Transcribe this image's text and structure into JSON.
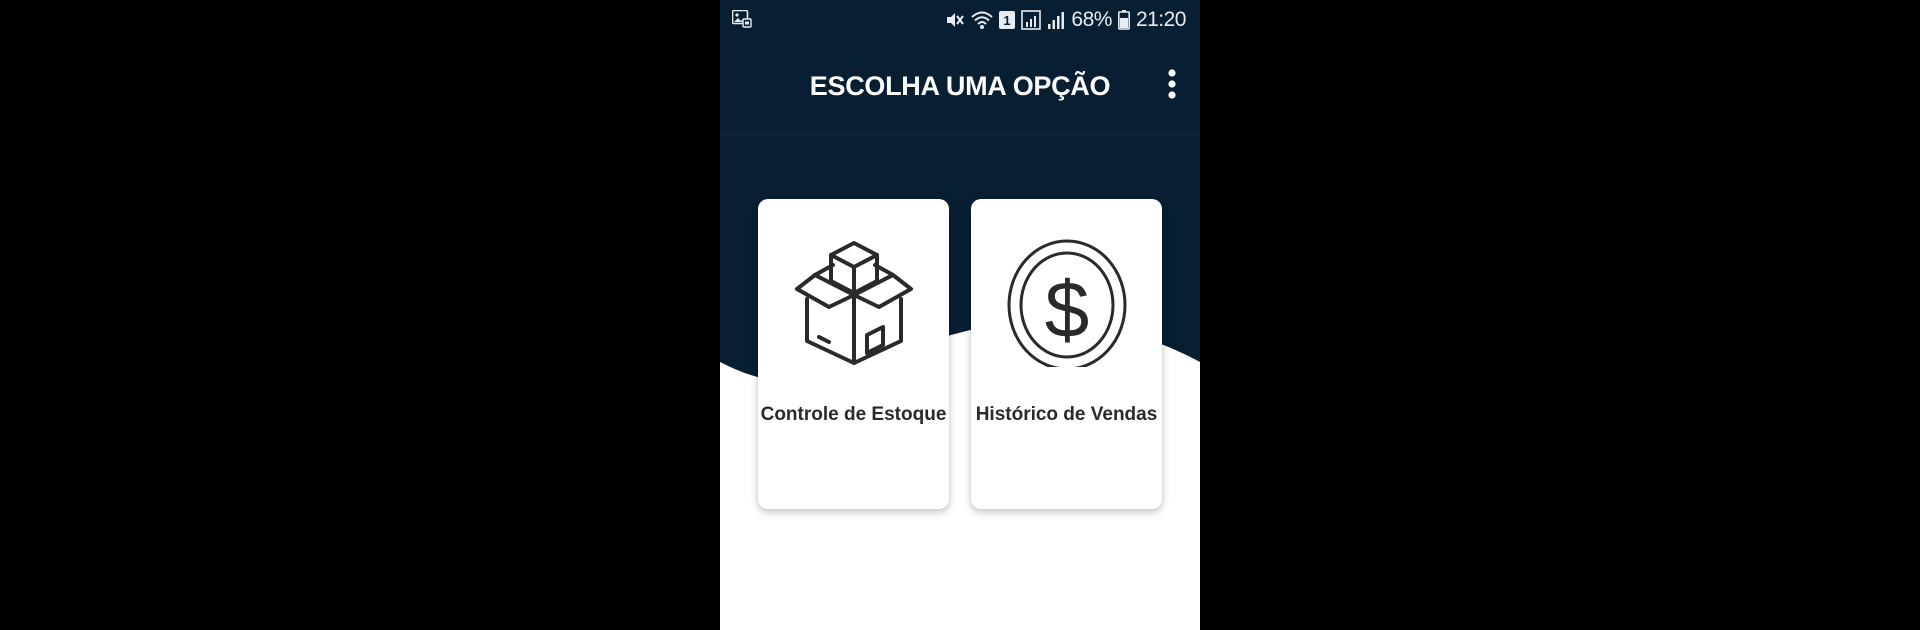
{
  "status_bar": {
    "battery_percent": "68%",
    "time": "21:20",
    "sim_badge": "1",
    "icons": [
      "gallery-notification-icon",
      "mute-icon",
      "wifi-icon",
      "sim1-icon",
      "signal-icon",
      "battery-icon"
    ]
  },
  "app_bar": {
    "title": "ESCOLHA UMA OPÇÃO",
    "menu_icon": "more-vertical-icon"
  },
  "options": [
    {
      "label": "Controle de Estoque",
      "icon": "box-icon"
    },
    {
      "label": "Histórico de Vendas",
      "icon": "dollar-coin-icon"
    }
  ],
  "colors": {
    "header_bg": "#081f33",
    "body_bg": "#ffffff",
    "card_bg": "#ffffff",
    "icon_stroke": "#2a2a2a"
  }
}
